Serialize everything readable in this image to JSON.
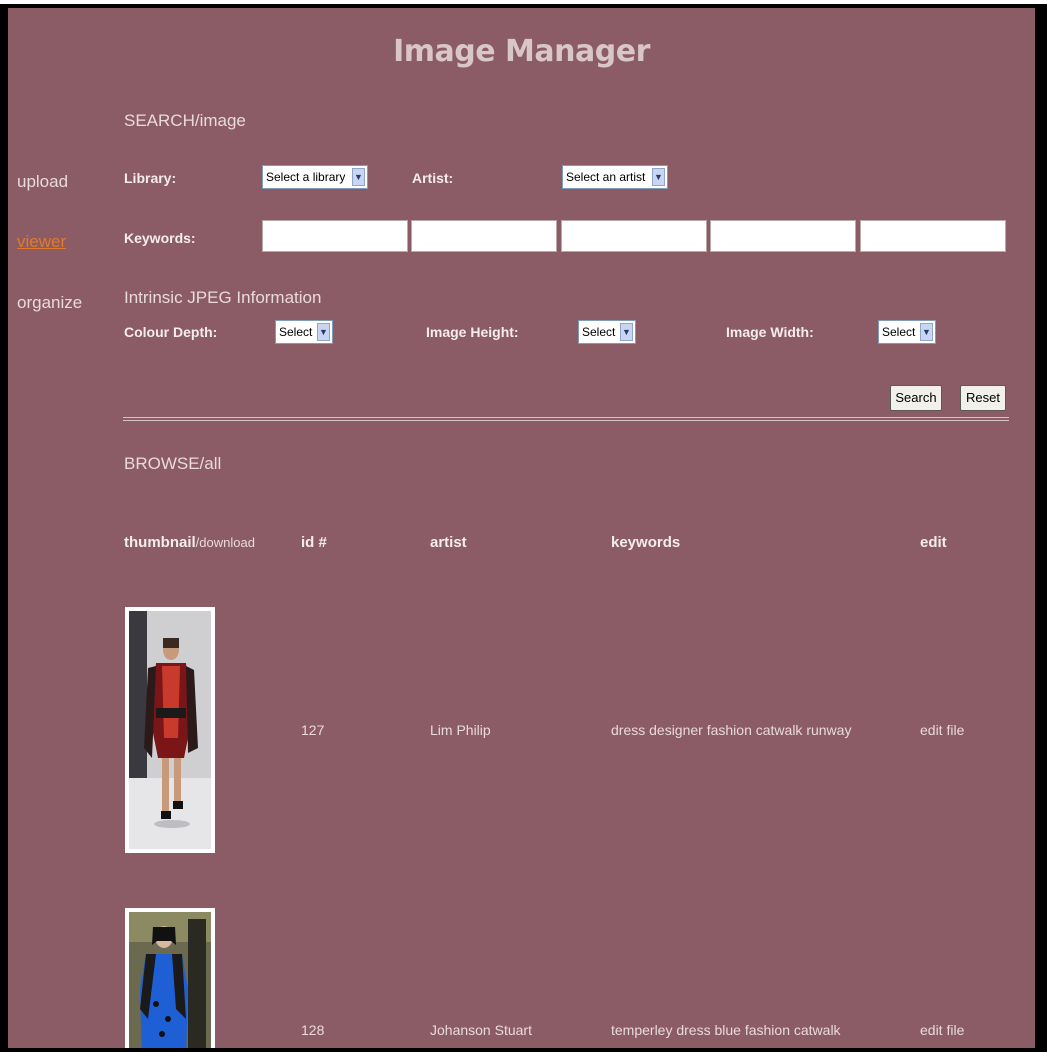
{
  "app": {
    "title": "Image Manager"
  },
  "nav": {
    "items": [
      "upload",
      "viewer",
      "organize"
    ],
    "active": "viewer"
  },
  "search": {
    "heading": "SEARCH/image",
    "library_label": "Library:",
    "library_value": "Select a library",
    "artist_label": "Artist:",
    "artist_value": "Select an artist",
    "keywords_label": "Keywords:",
    "keywords": [
      "",
      "",
      "",
      "",
      ""
    ],
    "jpeg_heading": "Intrinsic JPEG Information",
    "colour_depth_label": "Colour Depth:",
    "colour_depth_value": "Select",
    "height_label": "Image Height:",
    "height_value": "Select",
    "width_label": "Image Width:",
    "width_value": "Select",
    "search_button": "Search",
    "reset_button": "Reset"
  },
  "browse": {
    "heading": "BROWSE/all",
    "columns": {
      "thumbnail": "thumbnail",
      "download": "/download",
      "id": "id #",
      "artist": "artist",
      "keywords": "keywords",
      "edit": "edit"
    },
    "rows": [
      {
        "id": "127",
        "artist": "Lim Philip",
        "keywords": "dress designer fashion catwalk runway",
        "edit": "edit file"
      },
      {
        "id": "128",
        "artist": "Johanson Stuart",
        "keywords": "temperley dress blue fashion catwalk",
        "edit": "edit file"
      }
    ]
  },
  "colors": {
    "background": "#8b5c65",
    "accent": "#e07a2c",
    "text": "#e8dadd"
  }
}
